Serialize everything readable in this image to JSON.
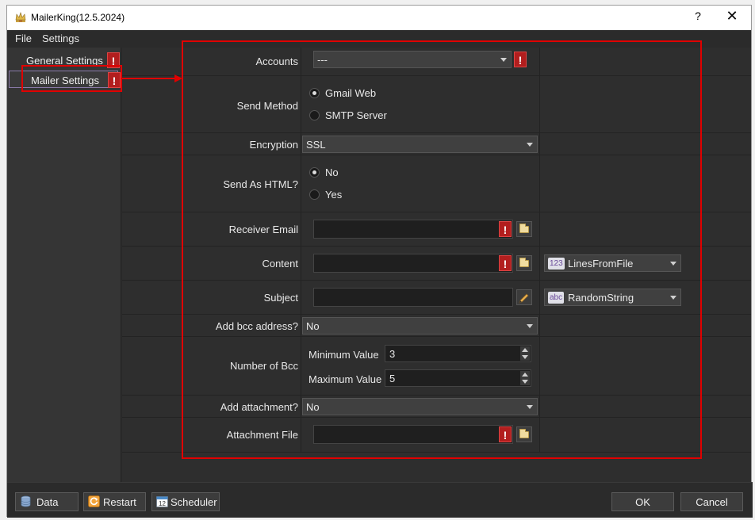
{
  "window": {
    "title": "MailerKing(12.5.2024)",
    "help_label": "?",
    "close_label": "✕"
  },
  "menu": {
    "file": "File",
    "settings": "Settings"
  },
  "sidebar": {
    "items": [
      {
        "label": "General Settings",
        "error": "!"
      },
      {
        "label": "Mailer Settings",
        "error": "!"
      }
    ]
  },
  "form": {
    "accounts": {
      "label": "Accounts",
      "value": "---",
      "error": "!"
    },
    "send_method": {
      "label": "Send Method",
      "options": [
        "Gmail Web",
        "SMTP Server"
      ],
      "selected": "Gmail Web"
    },
    "encryption": {
      "label": "Encryption",
      "value": "SSL"
    },
    "send_as_html": {
      "label": "Send As HTML?",
      "options": [
        "No",
        "Yes"
      ],
      "selected": "No"
    },
    "receiver_email": {
      "label": "Receiver Email",
      "value": "",
      "error": "!"
    },
    "content": {
      "label": "Content",
      "value": "",
      "error": "!",
      "generator_badge": "123",
      "generator": "LinesFromFile"
    },
    "subject": {
      "label": "Subject",
      "value": "",
      "generator_badge": "abc",
      "generator": "RandomString"
    },
    "add_bcc": {
      "label": "Add bcc address?",
      "value": "No"
    },
    "number_of_bcc": {
      "label": "Number of Bcc",
      "min_label": "Minimum Value",
      "min_value": "3",
      "max_label": "Maximum Value",
      "max_value": "5"
    },
    "add_attachment": {
      "label": "Add attachment?",
      "value": "No"
    },
    "attachment_file": {
      "label": "Attachment File",
      "value": "",
      "error": "!"
    }
  },
  "footer": {
    "data": "Data",
    "restart": "Restart",
    "scheduler": "Scheduler",
    "scheduler_icon_day": "12",
    "ok": "OK",
    "cancel": "Cancel"
  },
  "colors": {
    "error_badge": "#b21e1e",
    "annotation": "#e00000",
    "window_bg": "#2b2b2b"
  }
}
